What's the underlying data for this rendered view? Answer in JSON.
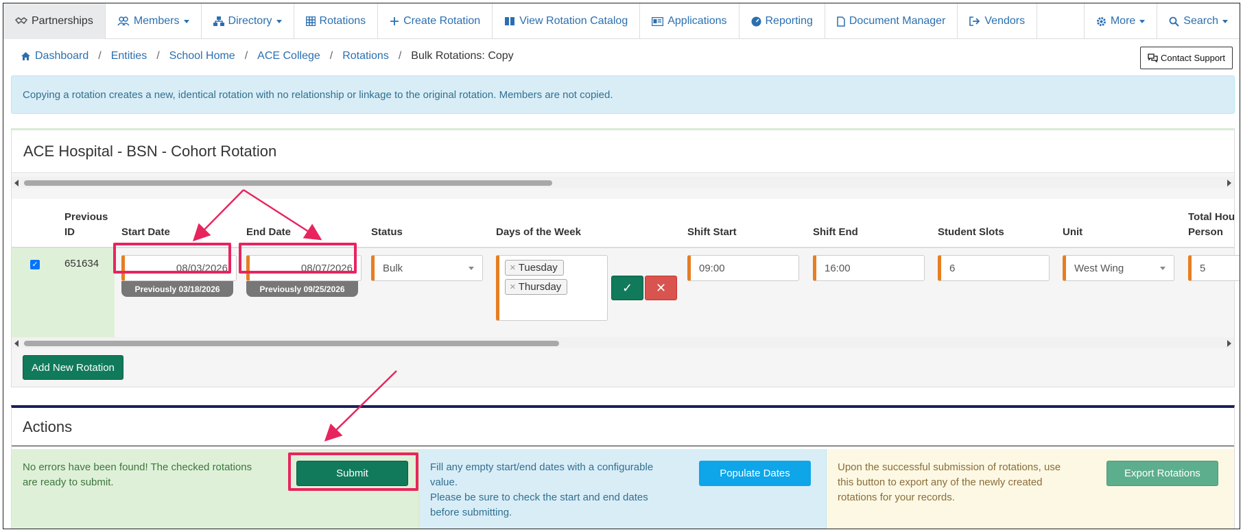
{
  "nav": {
    "items": [
      {
        "label": "Partnerships",
        "icon": "handshake-icon",
        "active": true
      },
      {
        "label": "Members",
        "icon": "users-icon",
        "dropdown": true
      },
      {
        "label": "Directory",
        "icon": "sitemap-icon",
        "dropdown": true
      },
      {
        "label": "Rotations",
        "icon": "calendar-grid-icon"
      },
      {
        "label": "Create Rotation",
        "icon": "plus-icon"
      },
      {
        "label": "View Rotation Catalog",
        "icon": "book-icon"
      },
      {
        "label": "Applications",
        "icon": "id-card-icon"
      },
      {
        "label": "Reporting",
        "icon": "dashboard-gauge-icon"
      },
      {
        "label": "Document Manager",
        "icon": "file-icon"
      },
      {
        "label": "Vendors",
        "icon": "sign-out-icon"
      }
    ],
    "right_items": [
      {
        "label": "More",
        "icon": "gear-icon",
        "dropdown": true
      },
      {
        "label": "Search",
        "icon": "search-icon",
        "dropdown": true
      }
    ]
  },
  "breadcrumb": {
    "items": [
      "Dashboard",
      "Entities",
      "School Home",
      "ACE College",
      "Rotations"
    ],
    "current": "Bulk Rotations: Copy"
  },
  "contact_support": "Contact Support",
  "info_message": "Copying a rotation creates a new, identical rotation with no relationship or linkage to the original rotation. Members are not copied.",
  "rotation_panel": {
    "title": "ACE Hospital - BSN - Cohort Rotation",
    "headers": {
      "previous_id": "Previous ID",
      "start_date": "Start Date",
      "end_date": "End Date",
      "status": "Status",
      "days": "Days of the Week",
      "shift_start": "Shift Start",
      "shift_end": "Shift End",
      "student_slots": "Student Slots",
      "unit": "Unit",
      "total_hours": "Total Hou Person"
    },
    "row": {
      "checked": true,
      "previous_id": "651634",
      "start_date": "08/03/2026",
      "start_prev": "Previously 03/18/2026",
      "end_date": "08/07/2026",
      "end_prev": "Previously 09/25/2026",
      "status": "Bulk",
      "days": [
        "Tuesday",
        "Thursday"
      ],
      "shift_start": "09:00",
      "shift_end": "16:00",
      "student_slots": "6",
      "unit": "West Wing",
      "total_hours": "5"
    },
    "add_button": "Add New Rotation"
  },
  "actions": {
    "title": "Actions",
    "submit_text": "No errors have been found! The checked rotations are ready to submit.",
    "submit_button": "Submit",
    "populate_text": "Fill any empty start/end dates with a configurable value.\nPlease be sure to check the start and end dates before submitting.",
    "populate_button": "Populate Dates",
    "export_text": "Upon the successful submission of rotations, use this button to export any of the newly created rotations for your records.",
    "export_button": "Export Rotations"
  },
  "colors": {
    "link": "#2a6fb0",
    "primary_green": "#107a5a",
    "annotation": "#e8245e",
    "required_marker": "#e67e22",
    "info_bg": "#d9edf7",
    "populate_button": "#0ea5e9",
    "export_button": "#5cae8c"
  }
}
